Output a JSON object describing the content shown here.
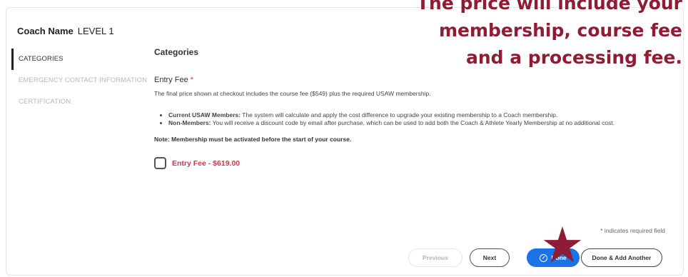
{
  "coach_header": {
    "name": "Coach Name",
    "level": "LEVEL 1"
  },
  "sidebar": {
    "items": [
      {
        "label": "CATEGORIES",
        "active": true
      },
      {
        "label": "EMERGENCY CONTACT INFORMATION",
        "active": false
      },
      {
        "label": "CERTIFICATION",
        "active": false
      }
    ]
  },
  "main": {
    "section_title": "Categories",
    "entry_fee_label": "Entry Fee",
    "required_marker": "*",
    "intro": "The final price shown at checkout includes the course fee ($549) plus the required USAW membership.",
    "bullets": [
      {
        "bold": "Current USAW Members:",
        "text": " The system will calculate and apply the cost difference to upgrade your existing membership to a Coach membership."
      },
      {
        "bold": "Non-Members:",
        "text": " You will receive a discount code by email after purchase, which can be used to add both the Coach & Athlete Yearly Membership at no additional cost."
      }
    ],
    "note": "Note: Membership must be activated before the start of your course.",
    "checkbox_label": "Entry Fee - $619.00",
    "required_field_note": "* indicates required field"
  },
  "buttons": {
    "previous": "Previous",
    "next": "Next",
    "done": "Done",
    "done_add_another": "Done & Add Another"
  },
  "overlay": {
    "lines": [
      "The price will include your",
      "membership, course fee",
      "and a processing fee."
    ],
    "color": "#8e1c34"
  },
  "colors": {
    "accent": "#1a73e8",
    "required": "#d6334b",
    "annotation": "#8e1c34"
  }
}
